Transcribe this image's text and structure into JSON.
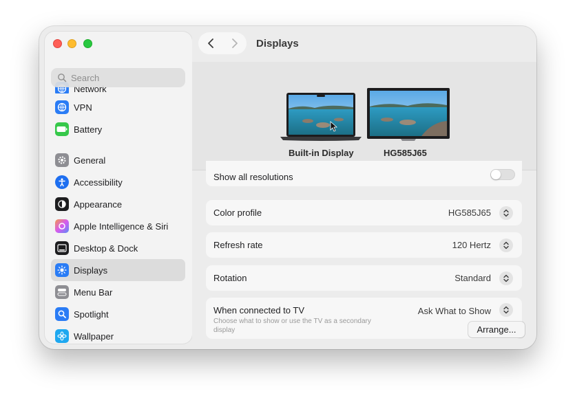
{
  "window": {
    "title": "Displays"
  },
  "sidebar": {
    "search_placeholder": "Search",
    "items": [
      {
        "label": "Network",
        "icon": "network-icon",
        "color": "#2a7cf5"
      },
      {
        "label": "VPN",
        "icon": "vpn-icon",
        "color": "#2a7cf5"
      },
      {
        "label": "Battery",
        "icon": "battery-icon",
        "color": "#36c84a"
      },
      {
        "label": "General",
        "icon": "gear-icon",
        "color": "#8e8e93"
      },
      {
        "label": "Accessibility",
        "icon": "accessibility-icon",
        "color": "#1e6ff0"
      },
      {
        "label": "Appearance",
        "icon": "appearance-icon",
        "color": "#1d1d1f"
      },
      {
        "label": "Apple Intelligence & Siri",
        "icon": "siri-icon",
        "color": "#c86bf0"
      },
      {
        "label": "Desktop & Dock",
        "icon": "desktop-dock-icon",
        "color": "#1d1d1f"
      },
      {
        "label": "Displays",
        "icon": "displays-icon",
        "color": "#2a7cf5",
        "selected": true
      },
      {
        "label": "Menu Bar",
        "icon": "menu-bar-icon",
        "color": "#8e8e93"
      },
      {
        "label": "Spotlight",
        "icon": "spotlight-icon",
        "color": "#2a7cf5"
      },
      {
        "label": "Wallpaper",
        "icon": "wallpaper-icon",
        "color": "#1ea8f0"
      }
    ]
  },
  "displays": [
    {
      "name": "Built-in Display",
      "selected": false
    },
    {
      "name": "HG585J65",
      "selected": true
    }
  ],
  "settings": {
    "show_all_resolutions": {
      "label": "Show all resolutions",
      "enabled": false
    },
    "color_profile": {
      "label": "Color profile",
      "value": "HG585J65"
    },
    "refresh_rate": {
      "label": "Refresh rate",
      "value": "120 Hertz"
    },
    "rotation": {
      "label": "Rotation",
      "value": "Standard"
    },
    "tv": {
      "label": "When connected to TV",
      "value": "Ask What to Show",
      "description": "Choose what to show or use the TV as a secondary display"
    }
  },
  "arrange_label": "Arrange..."
}
